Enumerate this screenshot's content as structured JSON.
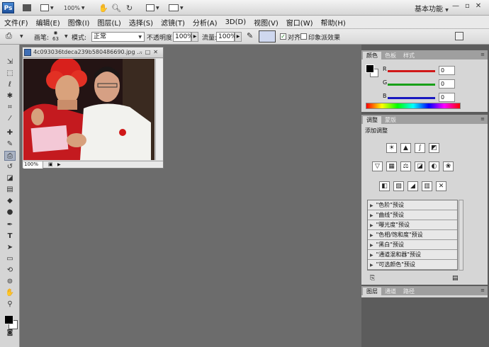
{
  "appbar": {
    "logo": "Ps",
    "zoom": "100%",
    "workspace": "基本功能",
    "icons": [
      "folder-icon",
      "bridge-icon",
      "view-extras-icon",
      "hand-icon",
      "zoom-icon",
      "rotate-icon",
      "arrange-icon",
      "screen-mode-icon"
    ],
    "window_buttons": [
      "—",
      "▫",
      "✕"
    ]
  },
  "menubar": {
    "items": [
      "文件(F)",
      "编辑(E)",
      "图像(I)",
      "图层(L)",
      "选择(S)",
      "滤镜(T)",
      "分析(A)",
      "3D(D)",
      "视图(V)",
      "窗口(W)",
      "帮助(H)"
    ]
  },
  "options": {
    "brush_label": "画笔:",
    "brush_size": "63",
    "mode_label": "模式:",
    "mode_value": "正常",
    "opacity_label": "不透明度:",
    "opacity_value": "100%",
    "flow_label": "流量:",
    "flow_value": "100%",
    "aligned_label": "对齐",
    "impressionist_label": "印象派效果"
  },
  "document": {
    "title": "4c093036tdeca239b580486690.jpg ...",
    "zoom": "100%"
  },
  "color_panel": {
    "tabs": [
      "颜色",
      "色板",
      "样式"
    ],
    "channels": [
      {
        "label": "R",
        "value": "0",
        "color": "#d01818"
      },
      {
        "label": "G",
        "value": "0",
        "color": "#18a018"
      },
      {
        "label": "B",
        "value": "0",
        "color": "#1818c0"
      }
    ]
  },
  "adjust_panel": {
    "tabs": [
      "调整",
      "蒙版"
    ],
    "heading": "添加调整",
    "presets": [
      "\"色阶\"预设",
      "\"曲线\"预设",
      "\"曝光度\"预设",
      "\"色相/饱和度\"预设",
      "\"黑白\"预设",
      "\"通道混和器\"预设",
      "\"可选颜色\"预设"
    ]
  },
  "layers_panel": {
    "tabs": [
      "图层",
      "通道",
      "路径"
    ]
  }
}
